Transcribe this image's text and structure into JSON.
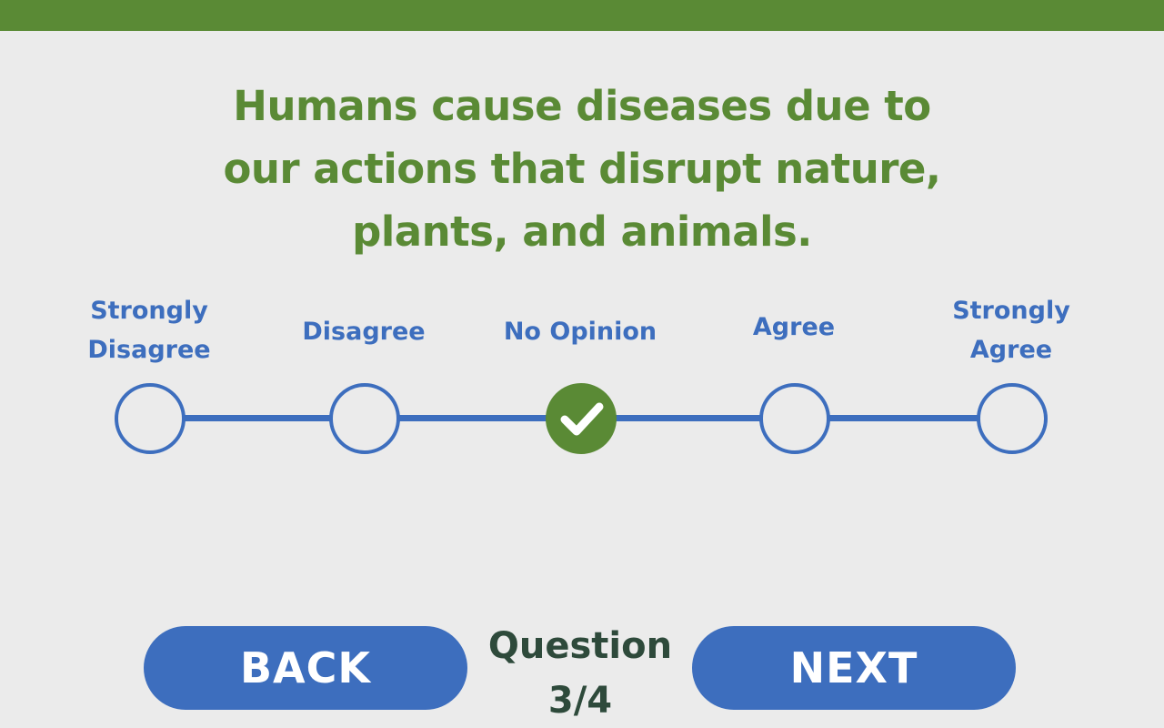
{
  "theme": {
    "accent_green": "#5a8a35",
    "accent_blue": "#3d6ebe",
    "dark_green": "#2e4a3b",
    "background": "#ebebeb"
  },
  "question": {
    "text": "Humans cause diseases due to our actions that disrupt nature, plants, and animals."
  },
  "scale": {
    "options": [
      {
        "label": "Strongly\nDisagree",
        "selected": false
      },
      {
        "label": "Disagree",
        "selected": false
      },
      {
        "label": "No Opinion",
        "selected": true,
        "icon": "checkmark-icon"
      },
      {
        "label": "Agree",
        "selected": false
      },
      {
        "label": "Strongly\nAgree",
        "selected": false
      }
    ]
  },
  "nav": {
    "back_label": "BACK",
    "next_label": "NEXT",
    "counter_label": "Question",
    "counter_value": "3/4"
  }
}
